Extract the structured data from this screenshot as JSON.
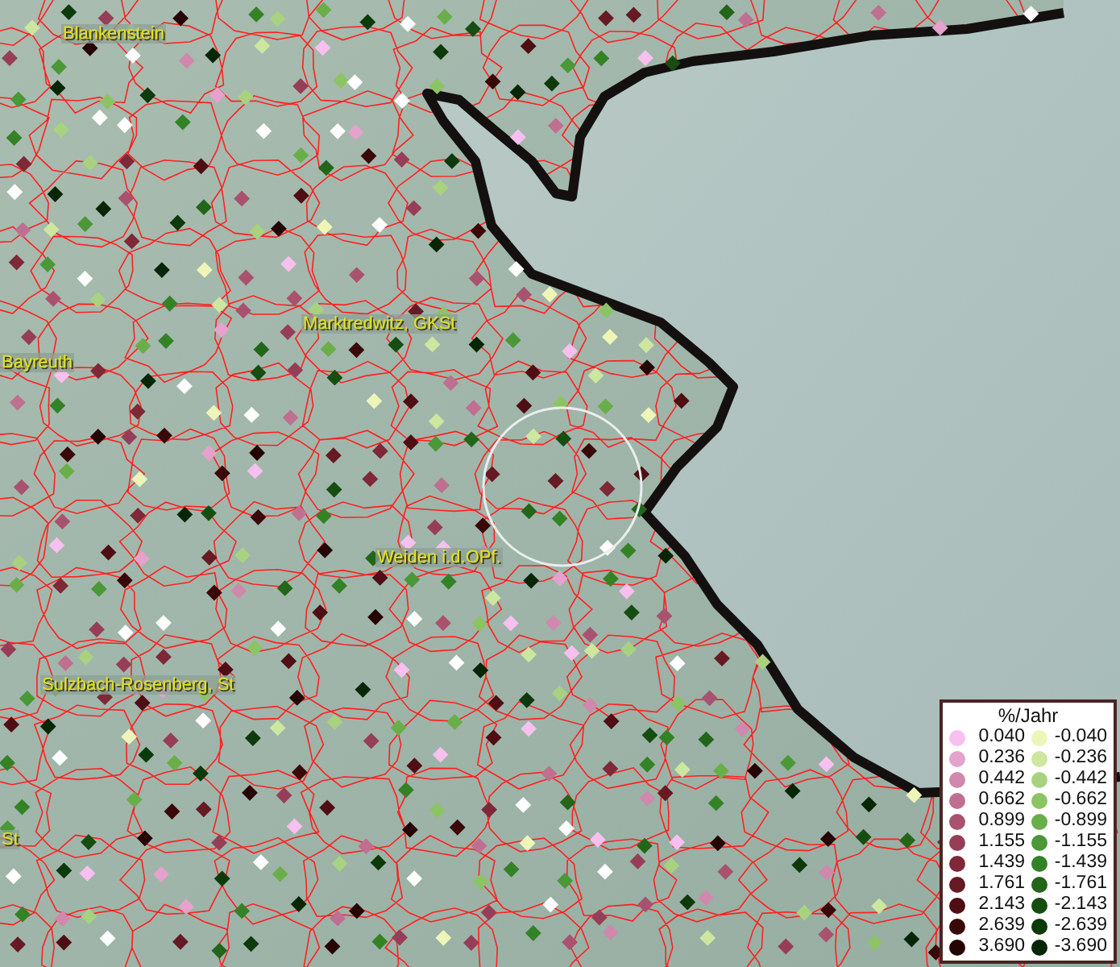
{
  "map": {
    "places": [
      {
        "name": "Blankenstein"
      },
      {
        "name": "Marktredwitz, GKSt"
      },
      {
        "name": "Bayreuth"
      },
      {
        "name": "Weiden i.d.OPf."
      },
      {
        "name": "Sulzbach-Rosenberg, St"
      },
      {
        "name": "St"
      }
    ]
  },
  "legend": {
    "title": "%/Jahr",
    "items": [
      {
        "label": "0.040",
        "color": "#f7c0ef"
      },
      {
        "label": "-0.040",
        "color": "#eef5b8"
      },
      {
        "label": "0.236",
        "color": "#e4a2cc"
      },
      {
        "label": "-0.236",
        "color": "#cde6a0"
      },
      {
        "label": "0.442",
        "color": "#d088ac"
      },
      {
        "label": "-0.442",
        "color": "#a8d280"
      },
      {
        "label": "0.662",
        "color": "#bf6f90"
      },
      {
        "label": "-0.662",
        "color": "#8cc464"
      },
      {
        "label": "0.899",
        "color": "#a95270"
      },
      {
        "label": "-0.899",
        "color": "#6aae4a"
      },
      {
        "label": "1.155",
        "color": "#963e58"
      },
      {
        "label": "-1.155",
        "color": "#4a9838"
      },
      {
        "label": "1.439",
        "color": "#7e2838"
      },
      {
        "label": "-1.439",
        "color": "#348226"
      },
      {
        "label": "1.761",
        "color": "#661a24"
      },
      {
        "label": "-1.761",
        "color": "#23661a"
      },
      {
        "label": "2.143",
        "color": "#4e0e14"
      },
      {
        "label": "-2.143",
        "color": "#154e10"
      },
      {
        "label": "2.639",
        "color": "#3a0808"
      },
      {
        "label": "-2.639",
        "color": "#0c3a0a"
      },
      {
        "label": "3.690",
        "color": "#250404"
      },
      {
        "label": "-3.690",
        "color": "#062606"
      }
    ]
  }
}
